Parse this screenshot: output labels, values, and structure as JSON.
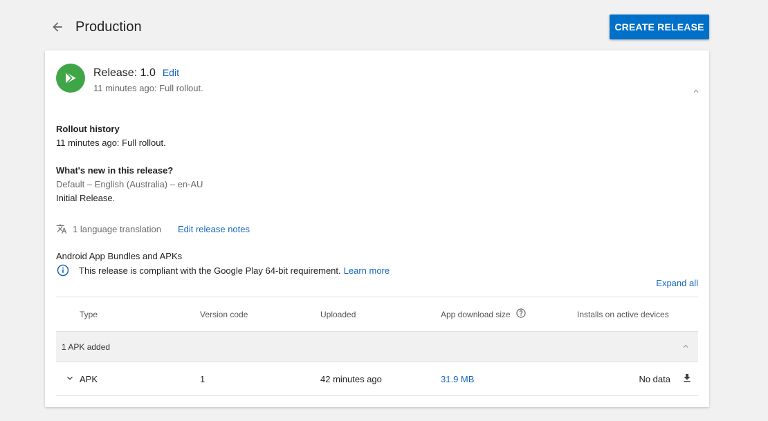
{
  "header": {
    "title": "Production",
    "create_label": "CREATE RELEASE"
  },
  "release": {
    "title": "Release: 1.0",
    "edit_label": "Edit",
    "subtitle": "11 minutes ago: Full rollout.",
    "logo_icon": "play-store-icon",
    "logo_color": "#3fa648"
  },
  "rollout": {
    "heading": "Rollout history",
    "text": "11 minutes ago: Full rollout."
  },
  "whats_new": {
    "heading": "What's new in this release?",
    "locale": "Default – English (Australia) – en-AU",
    "text": "Initial Release."
  },
  "translation": {
    "count_text": "1 language translation",
    "edit_notes_label": "Edit release notes"
  },
  "bundles": {
    "heading": "Android App Bundles and APKs",
    "compliance_text": "This release is compliant with the Google Play 64-bit requirement.",
    "learn_more": "Learn more",
    "expand_all": "Expand all"
  },
  "table": {
    "columns": [
      "Type",
      "Version code",
      "Uploaded",
      "App download size",
      "Installs on active devices"
    ],
    "group_label": "1 APK added",
    "rows": [
      {
        "type": "APK",
        "version_code": "1",
        "uploaded": "42 minutes ago",
        "size": "31.9 MB",
        "installs": "No data"
      }
    ]
  },
  "colors": {
    "accent": "#0070c9",
    "link": "#1565c0",
    "background": "#f1f1f1"
  }
}
